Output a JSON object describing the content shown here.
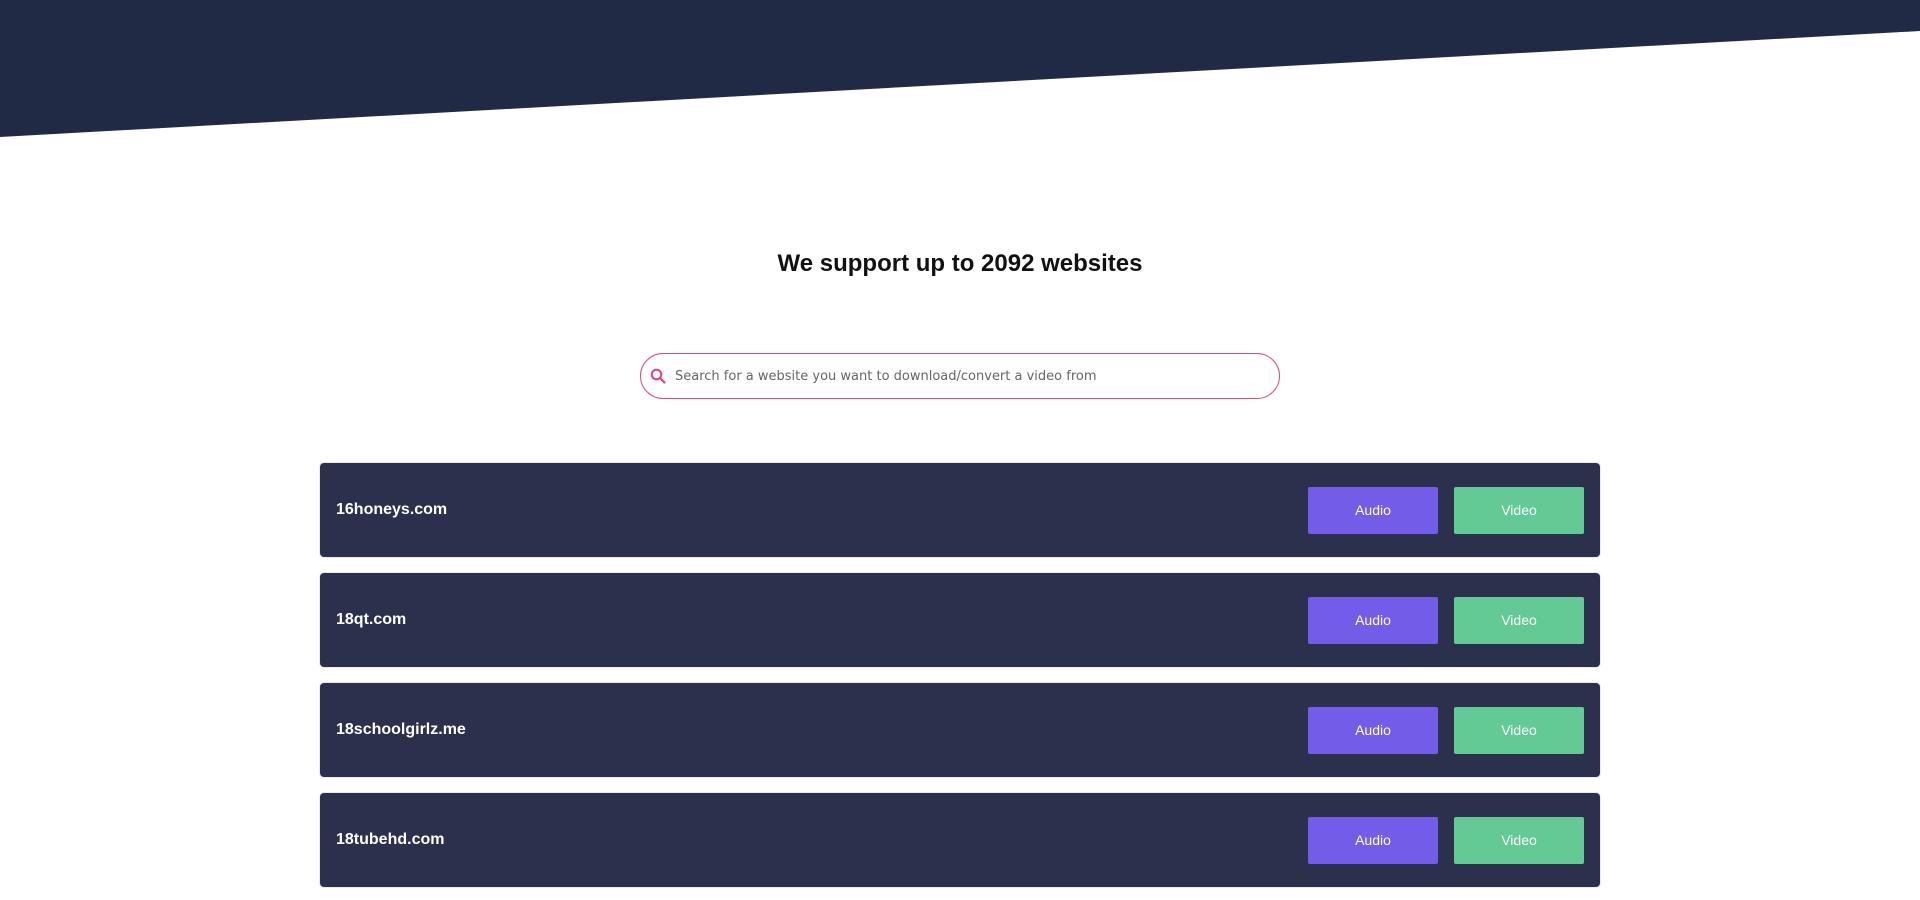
{
  "colors": {
    "banner": "#212a45",
    "row_background": "#2b314d",
    "audio_button": "#735ce8",
    "video_button": "#63c995",
    "search_border": "#e0457b"
  },
  "heading": "We support up to 2092 websites",
  "search": {
    "placeholder": "Search for a website you want to download/convert a video from",
    "value": "",
    "icon": "search-icon"
  },
  "sites": [
    {
      "name": "16honeys.com",
      "audio_label": "Audio",
      "video_label": "Video"
    },
    {
      "name": "18qt.com",
      "audio_label": "Audio",
      "video_label": "Video"
    },
    {
      "name": "18schoolgirlz.me",
      "audio_label": "Audio",
      "video_label": "Video"
    },
    {
      "name": "18tubehd.com",
      "audio_label": "Audio",
      "video_label": "Video"
    }
  ]
}
